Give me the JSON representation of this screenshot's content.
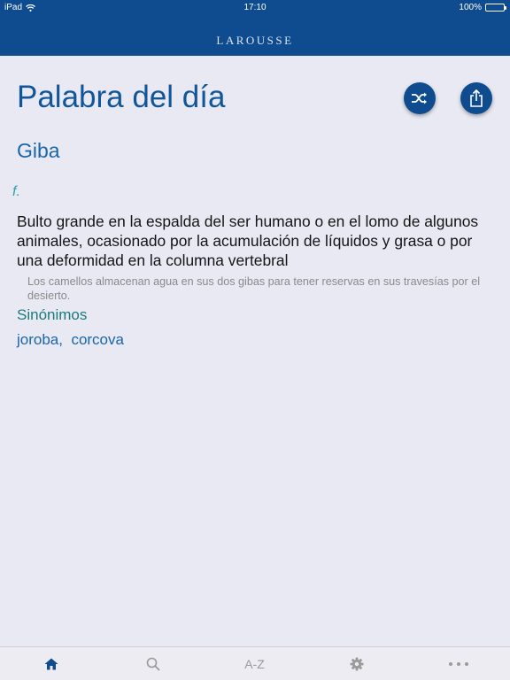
{
  "status": {
    "device": "iPad",
    "time": "17:10",
    "battery": "100%"
  },
  "header": {
    "brand": "LAROUSSE"
  },
  "main": {
    "title": "Palabra del día",
    "word": "Giba",
    "part_of_speech": "f.",
    "definition": "Bulto grande en la espalda del ser humano o en el lomo de algunos animales, ocasionado por la acumulación de líquidos y grasa o por una deformidad en la columna vertebral",
    "example": "Los camellos almacenan agua en sus dos gibas para tener reservas en sus travesías por el desierto.",
    "synonyms_label": "Sinónimos",
    "synonyms": [
      "joroba,",
      "corcova"
    ]
  },
  "actions": {
    "shuffle_icon": "shuffle-icon",
    "share_icon": "share-icon"
  },
  "tabbar": {
    "items": [
      {
        "icon": "home-icon",
        "label": ""
      },
      {
        "icon": "search-icon",
        "label": ""
      },
      {
        "icon": "",
        "label": "A-Z"
      },
      {
        "icon": "gear-icon",
        "label": ""
      },
      {
        "icon": "more-icon",
        "label": ""
      }
    ],
    "active_index": 0
  },
  "colors": {
    "brand_blue": "#0f4c8f",
    "title_blue": "#12569a",
    "teal": "#1b7b7b",
    "background": "#e9e9f4"
  }
}
